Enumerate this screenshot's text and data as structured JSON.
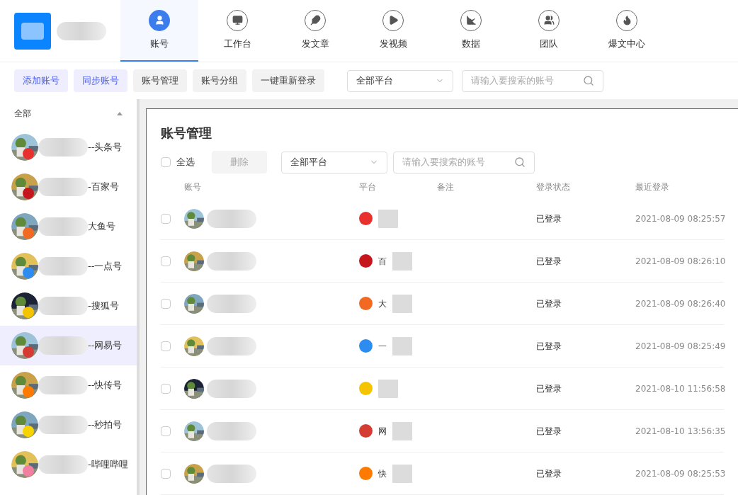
{
  "nav": [
    {
      "label": "账号",
      "selected": true
    },
    {
      "label": "工作台",
      "selected": false
    },
    {
      "label": "发文章",
      "selected": false
    },
    {
      "label": "发视频",
      "selected": false
    },
    {
      "label": "数据",
      "selected": false
    },
    {
      "label": "团队",
      "selected": false
    },
    {
      "label": "爆文中心",
      "selected": false
    }
  ],
  "toolbar": {
    "buttons": [
      {
        "label": "添加账号",
        "kind": "primary"
      },
      {
        "label": "同步账号",
        "kind": "primary"
      },
      {
        "label": "账号管理",
        "kind": "plain"
      },
      {
        "label": "账号分组",
        "kind": "plain"
      },
      {
        "label": "一键重新登录",
        "kind": "plain"
      }
    ],
    "platform_select": "全部平台",
    "search": {
      "placeholder": "请输入要搜索的账号"
    }
  },
  "sidebar": {
    "group": {
      "label": "全部",
      "expanded": true
    },
    "items": [
      {
        "suffix": "--头条号",
        "selected": false,
        "color": "#e8312f"
      },
      {
        "suffix": "-百家号",
        "selected": false,
        "color": "#c4161c"
      },
      {
        "suffix": "大鱼号",
        "selected": false,
        "color": "#f26a21"
      },
      {
        "suffix": "--一点号",
        "selected": false,
        "color": "#2d8cf0"
      },
      {
        "suffix": "-搜狐号",
        "selected": false,
        "color": "#f5c400"
      },
      {
        "suffix": "--网易号",
        "selected": true,
        "color": "#d43c33"
      },
      {
        "suffix": "--快传号",
        "selected": false,
        "color": "#ff7a00"
      },
      {
        "suffix": "--秒拍号",
        "selected": false,
        "color": "#f7d400"
      },
      {
        "suffix": "-哔哩哔哩",
        "selected": false,
        "color": "#f07fa0"
      }
    ]
  },
  "dialog": {
    "title": "账号管理",
    "select_all": {
      "label": "全选",
      "checked": false
    },
    "delete_button": {
      "label": "删除",
      "disabled": true
    },
    "platform_select": "全部平台",
    "search": {
      "placeholder": "请输入要搜索的账号"
    },
    "table": {
      "columns": [
        "账号",
        "平台",
        "备注",
        "登录状态",
        "最近登录"
      ],
      "rows": [
        {
          "checked": false,
          "color": "#e8312f",
          "status": "已登录",
          "last_login": "2021-08-09 08:25:57"
        },
        {
          "checked": false,
          "platform": "百",
          "color": "#c4161c",
          "status": "已登录",
          "last_login": "2021-08-09 08:26:10"
        },
        {
          "checked": false,
          "platform": "大",
          "color": "#f26a21",
          "status": "已登录",
          "last_login": "2021-08-09 08:26:40"
        },
        {
          "checked": false,
          "platform": "一",
          "color": "#2d8cf0",
          "status": "已登录",
          "last_login": "2021-08-09 08:25:49"
        },
        {
          "checked": false,
          "color": "#f5c400",
          "status": "已登录",
          "last_login": "2021-08-10 11:56:58"
        },
        {
          "checked": false,
          "platform": "网",
          "color": "#d43c33",
          "status": "已登录",
          "last_login": "2021-08-10 13:56:35"
        },
        {
          "checked": false,
          "platform": "快",
          "color": "#ff7a00",
          "status": "已登录",
          "last_login": "2021-08-09 08:25:53"
        }
      ]
    }
  }
}
